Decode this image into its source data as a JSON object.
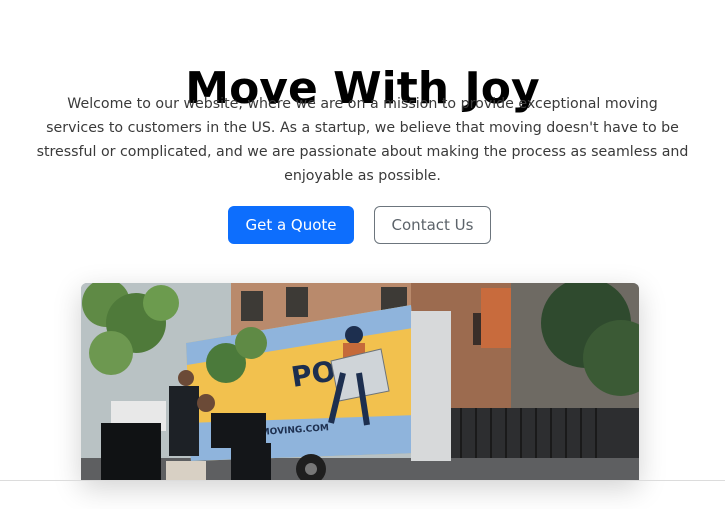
{
  "hero": {
    "title": "Move With Joy",
    "lead": "Welcome to our website, where we are on a mission to provide exceptional moving services to customers in the US. As a startup, we believe that moving doesn't have to be stressful or complicated, and we are passionate about making the process as seamless and enjoyable as possible.",
    "primary_button": "Get a Quote",
    "secondary_button": "Contact Us"
  },
  "truck": {
    "brand_text": "POLIS",
    "website_text": "MOVING.COM"
  },
  "colors": {
    "primary": "#0d6efd",
    "outline": "#6c757d",
    "truck_yellow": "#f2c14e",
    "truck_blue": "#2f6fb0"
  }
}
